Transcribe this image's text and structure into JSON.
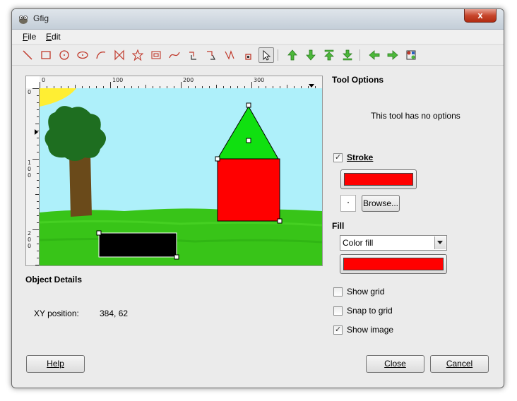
{
  "window": {
    "title": "Gfig",
    "close_symbol": "x"
  },
  "menu": [
    {
      "label": "File",
      "mnemonic": "F",
      "rest": "ile"
    },
    {
      "label": "Edit",
      "mnemonic": "E",
      "rest": "dit"
    }
  ],
  "toolbar": {
    "tools": [
      {
        "name": "line-tool-icon"
      },
      {
        "name": "rectangle-tool-icon"
      },
      {
        "name": "circle-tool-icon"
      },
      {
        "name": "ellipse-tool-icon"
      },
      {
        "name": "arc-tool-icon"
      },
      {
        "name": "polygon-tool-icon"
      },
      {
        "name": "star-tool-icon"
      },
      {
        "name": "spiral-tool-icon"
      },
      {
        "name": "bezier-tool-icon"
      },
      {
        "name": "move-object-icon"
      },
      {
        "name": "move-point-icon"
      },
      {
        "name": "copy-object-icon"
      },
      {
        "name": "delete-object-icon"
      },
      {
        "name": "select-pointer-icon"
      }
    ],
    "order": [
      {
        "name": "raise-object-icon"
      },
      {
        "name": "lower-object-icon"
      },
      {
        "name": "raise-to-top-icon"
      },
      {
        "name": "lower-to-bottom-icon"
      }
    ],
    "nav": [
      {
        "name": "previous-object-icon"
      },
      {
        "name": "next-object-icon"
      },
      {
        "name": "show-all-objects-icon"
      }
    ]
  },
  "ruler": {
    "h_labels": [
      "0",
      "100",
      "200",
      "300"
    ],
    "v_labels": [
      "0",
      "1\n0\n0",
      "2\n0\n0"
    ]
  },
  "object_details": {
    "title": "Object Details",
    "xy_label": "XY position:",
    "xy_value": "384, 62"
  },
  "tool_options": {
    "title": "Tool Options",
    "message": "This tool has no options"
  },
  "stroke": {
    "label": "Stroke",
    "checked": true,
    "color": "#ff0000",
    "browse_label": "Browse...",
    "brush_preview": "·"
  },
  "fill": {
    "label": "Fill",
    "selected": "Color fill",
    "color": "#ff0000"
  },
  "options": [
    {
      "label": "Show grid",
      "checked": false
    },
    {
      "label": "Snap to grid",
      "checked": false
    },
    {
      "label": "Show image",
      "checked": true
    }
  ],
  "buttons": {
    "help": "Help",
    "close": "Close",
    "cancel": "Cancel"
  },
  "colors": {
    "sky": "#aef0fa",
    "grass": "#38c418",
    "roof": "#10e010",
    "house": "#ff0000",
    "trunk": "#6a4a1a",
    "tree": "#1e6e20",
    "sun": "#ffee33"
  }
}
